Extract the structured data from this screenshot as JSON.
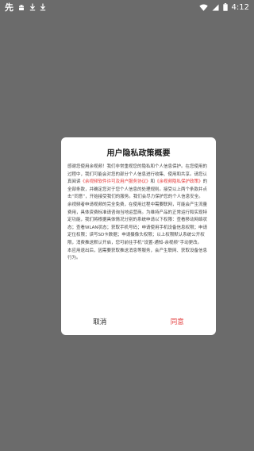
{
  "status_bar": {
    "time": "4:12",
    "app_logo_text": "先",
    "icons": [
      "app-logo-icon",
      "android-icon",
      "download-icon",
      "download-icon",
      "wifi-icon",
      "signal-icon",
      "battery-icon"
    ]
  },
  "dialog": {
    "title": "用户隐私政策概要",
    "body": {
      "p1_a": "感谢您使用余视频！我们非常重视您的隐私和个人信息保护。在您使用的过程中，我们可能会对您的部分个人信息进行收集、使用和共享。请您认真阅读",
      "link1": "《余视频软件许可及用户服务协议》",
      "p1_b": "和",
      "link2": "《余视频隐私保护政策》",
      "p1_c": "的全部条款，并确定您对于您个人信息的处理规则。接受以上两个条款并点击“同意”，开始接受我们的服务。我们会尽力保护您的个人信息安全。",
      "p2": "余视频者申请视频的完全免费，在使用过程中需要联网，可能会产生流量费用，具体资费标准请咨询当地运营商。为维持产品的正常运行和实现特定功能，我们将根据具体情况分别的系统申请以下权限：查看移动网络状态；查看WLAN状态；获取手机号码；申请使用手机设备信息权限；申请定位权限；读写SD卡数据；申请摄像头权限；以上权限默认系统公开权限，消费推送默认开启，您可前往手机“设置-通知-余视频”手动更改。",
      "p3": "本应用退出后，因需要获取推送消息等服务，会产生联网、获取设备信息行为。"
    },
    "cancel_label": "取消",
    "agree_label": "同意"
  }
}
